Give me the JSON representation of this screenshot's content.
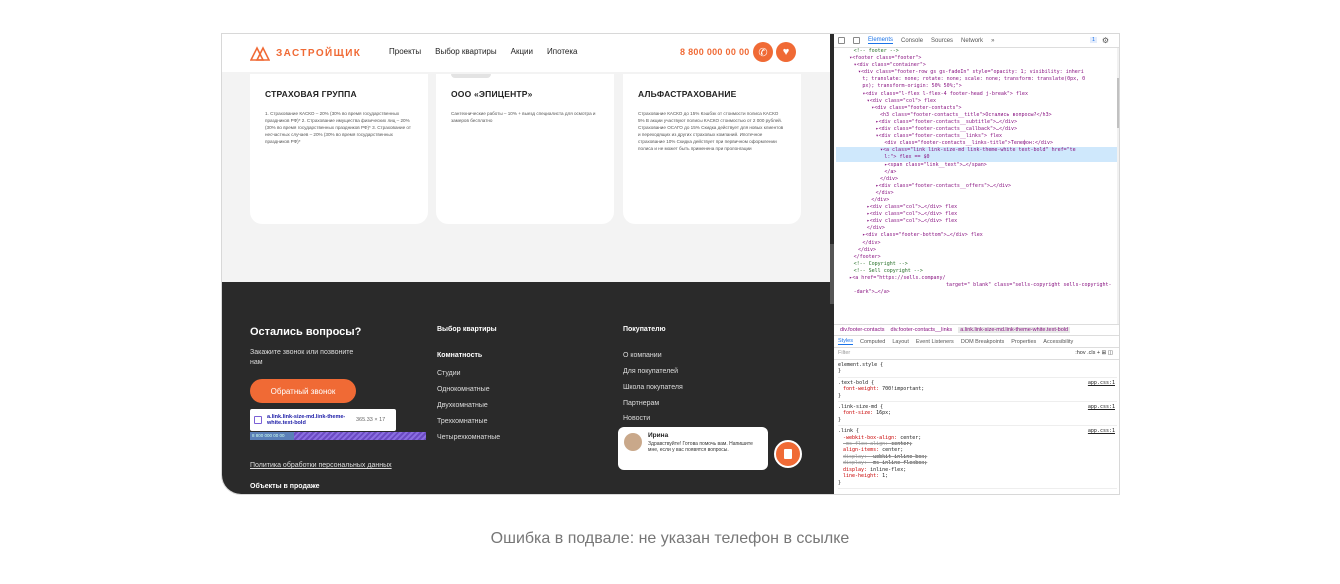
{
  "site": {
    "logo_text": "ЗАСТРОЙЩИК",
    "nav": [
      "Проекты",
      "Выбор квартиры",
      "Акции",
      "Ипотека"
    ],
    "phone": "8 800 000 00 00",
    "accent": "#f06a35"
  },
  "cards": [
    {
      "title": "СТРАХОВАЯ ГРУППА",
      "text": "1. Страхование КАСКО – 20% (30% во время государственных праздников РФ)* 2. Страхование имущества физических лиц – 20% (30% во время государственных праздников РФ)* 3. Страхование от несчастных случаев – 20% (30% во время государственных праздников РФ)*"
    },
    {
      "title": "ООО «ЭПИЦЕНТР»",
      "text": "Сантехнические работы – 10% + выезд специалиста для осмотра и замеров бесплатно"
    },
    {
      "title": "АЛЬФАСТРАХОВАНИЕ",
      "text": "Страхование КАСКО до 15% Кэшбэк от стоимости полиса КАСКО 5% В акции участвуют полисы КАСКО стоимостью от 2 000 рублей. Страхование ОСАГО до 15% Скидка действует для новых клиентов и переходящих из других страховых компаний. Ипотечное страхование 10% Скидка действует при первичном оформлении полиса и не может быть применена при пролонгации"
    }
  ],
  "footer": {
    "title": "Остались вопросы?",
    "subtitle": "Закажите звонок или позвоните нам",
    "callback_label": "Обратный звонок",
    "tooltip_name": "a.link.link-size-md.link-theme-white.text-bold",
    "tooltip_size": "365.33 × 17",
    "highlight_text": "8 800 000 00 00",
    "col1_title": "Выбор квартиры",
    "col1_links": [
      "Комнатность",
      "Студии",
      "Однокомнатные",
      "Двухкомнатные",
      "Трехкомнатные",
      "Четырехкомнатные"
    ],
    "col2_title": "Покупателю",
    "col2_links": [
      "О компании",
      "Для покупателей",
      "Школа покупателя",
      "Партнерам",
      "Новости"
    ],
    "policy": "Политика обработки персональных данных",
    "objects": "Объекты в продаже"
  },
  "chat": {
    "name": "Ирина",
    "message": "Здравствуйте! Готова помочь вам. Напишите мне, если у вас появятся вопросы."
  },
  "devtools": {
    "tabs": [
      "Elements",
      "Console",
      "Sources",
      "Network",
      "»"
    ],
    "badge": "1",
    "dom_lines": [
      {
        "html": "&lt;!-- footer --&gt;",
        "indent": 8,
        "kind": "c"
      },
      {
        "html": "▾&lt;footer class=\"footer\"&gt;",
        "indent": 6
      },
      {
        "html": "▾&lt;div class=\"container\"&gt;",
        "indent": 8
      },
      {
        "html": "▾&lt;div class=\"footer-row gs gs-fadeIn\" style=\"opacity: 1; visibility: inheri",
        "indent": 10
      },
      {
        "html": "t; translate: none; rotate: none; scale: none; transform: translate(0px, 0",
        "indent": 12
      },
      {
        "html": "px); transform-origin: 50% 50%;\"&gt;",
        "indent": 12
      },
      {
        "html": "▾&lt;div class=\"l-flex l-flex-4 footer-head j-break\"&gt; flex",
        "indent": 12
      },
      {
        "html": "▾&lt;div class=\"col\"&gt; flex",
        "indent": 14
      },
      {
        "html": "▾&lt;div class=\"footer-contacts\"&gt;",
        "indent": 16
      },
      {
        "html": "&lt;h3 class=\"footer-contacts__title\"&gt;Остались вопросы?&lt;/h3&gt;",
        "indent": 20
      },
      {
        "html": "▸&lt;div class=\"footer-contacts__subtitle\"&gt;…&lt;/div&gt;",
        "indent": 18
      },
      {
        "html": "▸&lt;div class=\"footer-contacts__callback\"&gt;…&lt;/div&gt;",
        "indent": 18
      },
      {
        "html": "▾&lt;div class=\"footer-contacts__links\"&gt; flex",
        "indent": 18
      },
      {
        "html": "&lt;div class=\"footer-contacts__links-title\"&gt;Телефон:&lt;/div&gt;",
        "indent": 22
      },
      {
        "html": "▾&lt;a class=\"link link-size-md link-theme-white text-bold\" href=\"te",
        "indent": 20,
        "sel": true
      },
      {
        "html": "l:\"&gt; flex == $0",
        "indent": 22,
        "sel": true
      },
      {
        "html": "▸&lt;span class=\"link__text\"&gt;…&lt;/span&gt;",
        "indent": 22
      },
      {
        "html": "&lt;/a&gt;",
        "indent": 22
      },
      {
        "html": "&lt;/div&gt;",
        "indent": 20
      },
      {
        "html": "▸&lt;div class=\"footer-contacts__offers\"&gt;…&lt;/div&gt;",
        "indent": 18
      },
      {
        "html": "&lt;/div&gt;",
        "indent": 18
      },
      {
        "html": "&lt;/div&gt;",
        "indent": 16
      },
      {
        "html": "▸&lt;div class=\"col\"&gt;…&lt;/div&gt; flex",
        "indent": 14
      },
      {
        "html": "▸&lt;div class=\"col\"&gt;…&lt;/div&gt; flex",
        "indent": 14
      },
      {
        "html": "▸&lt;div class=\"col\"&gt;…&lt;/div&gt; flex",
        "indent": 14
      },
      {
        "html": "&lt;/div&gt;",
        "indent": 14
      },
      {
        "html": "▸&lt;div class=\"footer-bottom\"&gt;…&lt;/div&gt; flex",
        "indent": 12
      },
      {
        "html": "&lt;/div&gt;",
        "indent": 12
      },
      {
        "html": "&lt;/div&gt;",
        "indent": 10
      },
      {
        "html": "&lt;/footer&gt;",
        "indent": 8
      },
      {
        "html": "&lt;!-- Copyright --&gt;",
        "indent": 8,
        "kind": "c"
      },
      {
        "html": "&lt;!-- Sell copyright --&gt;",
        "indent": 8,
        "kind": "c"
      },
      {
        "html": "▸&lt;a href=\"https://sells.company/",
        "indent": 6
      },
      {
        "html": "target=\" blank\" class=\"sells-copyright sells-copyright-",
        "indent": 50
      },
      {
        "html": "-dark\"&gt;…&lt;/a&gt;",
        "indent": 8
      }
    ],
    "crumbs": [
      "div.footer-contacts",
      "div.footer-contacts__links",
      "a.link.link-size-md.link-theme-white.text-bold"
    ],
    "subtabs": [
      "Styles",
      "Computed",
      "Layout",
      "Event Listeners",
      "DOM Breakpoints",
      "Properties",
      "Accessibility"
    ],
    "filter_placeholder": "Filter",
    "filter_tools": ":hov .cls + ⊞ ◫",
    "rules": [
      {
        "selector": "element.style {",
        "source": "",
        "props": []
      },
      {
        "selector": ".text-bold {",
        "source": "app.css:1",
        "props": [
          {
            "p": "font-weight",
            "v": "700!important;"
          }
        ]
      },
      {
        "selector": ".link-size-md {",
        "source": "app.css:1",
        "props": [
          {
            "p": "font-size",
            "v": "16px;"
          }
        ]
      },
      {
        "selector": ".link {",
        "source": "app.css:1",
        "props": [
          {
            "p": "-webkit-box-align",
            "v": "center;"
          },
          {
            "p": "-ms-flex-align",
            "v": "center;",
            "strike": true
          },
          {
            "p": "align-items",
            "v": "center;"
          },
          {
            "p": "display",
            "v": "-webkit-inline-box;",
            "strike": true
          },
          {
            "p": "display",
            "v": "-ms-inline-flexbox;",
            "strike": true
          },
          {
            "p": "display",
            "v": "inline-flex;"
          },
          {
            "p": "line-height",
            "v": "1;"
          }
        ]
      }
    ]
  },
  "caption": "Ошибка в подвале: не указан телефон в ссылке"
}
